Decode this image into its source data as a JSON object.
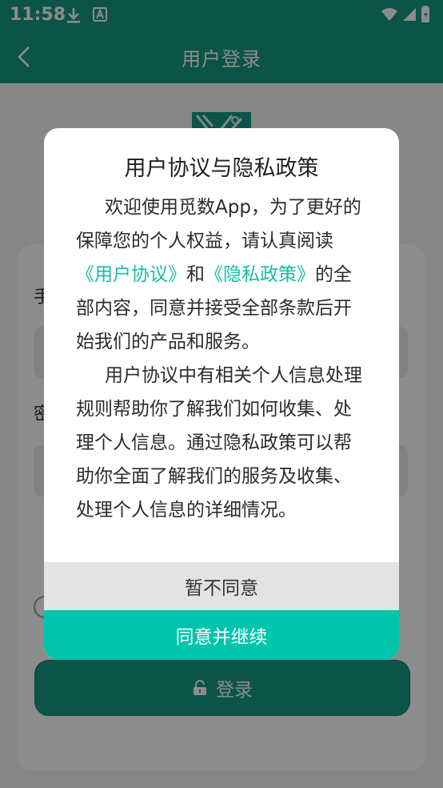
{
  "status_bar": {
    "time": "11:58",
    "icons": [
      "download-icon",
      "font-a-icon",
      "wifi-icon",
      "signal-icon",
      "battery-icon"
    ]
  },
  "app_bar": {
    "title": "用户登录",
    "back_icon": "chevron-left-icon"
  },
  "background": {
    "phone_label": "手",
    "password_label": "密",
    "login_button": "登录"
  },
  "dialog": {
    "title": "用户协议与隐私政策",
    "para1_pre": "欢迎使用觅数App，为了更好的保障您的个人权益，请认真阅读",
    "link_user_agreement": "《用户协议》",
    "and": "和",
    "link_privacy": "《隐私政策》",
    "para1_post": "的全部内容，同意并接受全部条款后开始我们的产品和服务。",
    "para2": "用户协议中有相关个人信息处理规则帮助你了解我们如何收集、处理个人信息。通过隐私政策可以帮助你全面了解我们的服务及收集、处理个人信息的详细情况。",
    "decline_button": "暂不同意",
    "accept_button": "同意并继续"
  },
  "colors": {
    "primary": "#159a82",
    "accent": "#00c4ac",
    "link": "#12bfa3"
  }
}
